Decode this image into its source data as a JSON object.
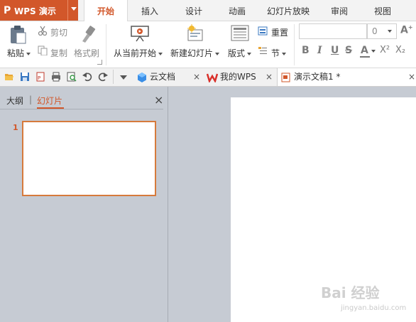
{
  "app": {
    "title": "WPS 演示",
    "logo": "P",
    "accent": "#d2572a"
  },
  "menu": {
    "tabs": [
      "开始",
      "插入",
      "设计",
      "动画",
      "幻灯片放映",
      "审阅",
      "视图"
    ],
    "active": "开始"
  },
  "ribbon": {
    "paste": "粘贴",
    "cut": "剪切",
    "copy": "复制",
    "format_painter": "格式刷",
    "from_current": "从当前开始",
    "new_slide": "新建幻灯片",
    "layout": "版式",
    "reset": "重置",
    "section": "节",
    "font_size": "0",
    "bold": "B",
    "italic": "I",
    "underline": "U",
    "strike": "S",
    "font_color": "A",
    "superscript": "X²",
    "subscript": "X₂",
    "grow_font": "A",
    "shrink_font": "A"
  },
  "doc_tabs": [
    {
      "label": "云文档",
      "icon": "cloud-icon"
    },
    {
      "label": "我的WPS",
      "icon": "wps-logo-icon"
    },
    {
      "label": "演示文稿1 *",
      "icon": "presentation-icon"
    }
  ],
  "left_pane": {
    "outline_tab": "大纲",
    "separator": "|",
    "slides_tab": "幻灯片",
    "close": "×",
    "slides": [
      {
        "number": "1"
      }
    ]
  },
  "watermark": {
    "brand": "Bai 经验",
    "url": "jingyan.baidu.com"
  }
}
